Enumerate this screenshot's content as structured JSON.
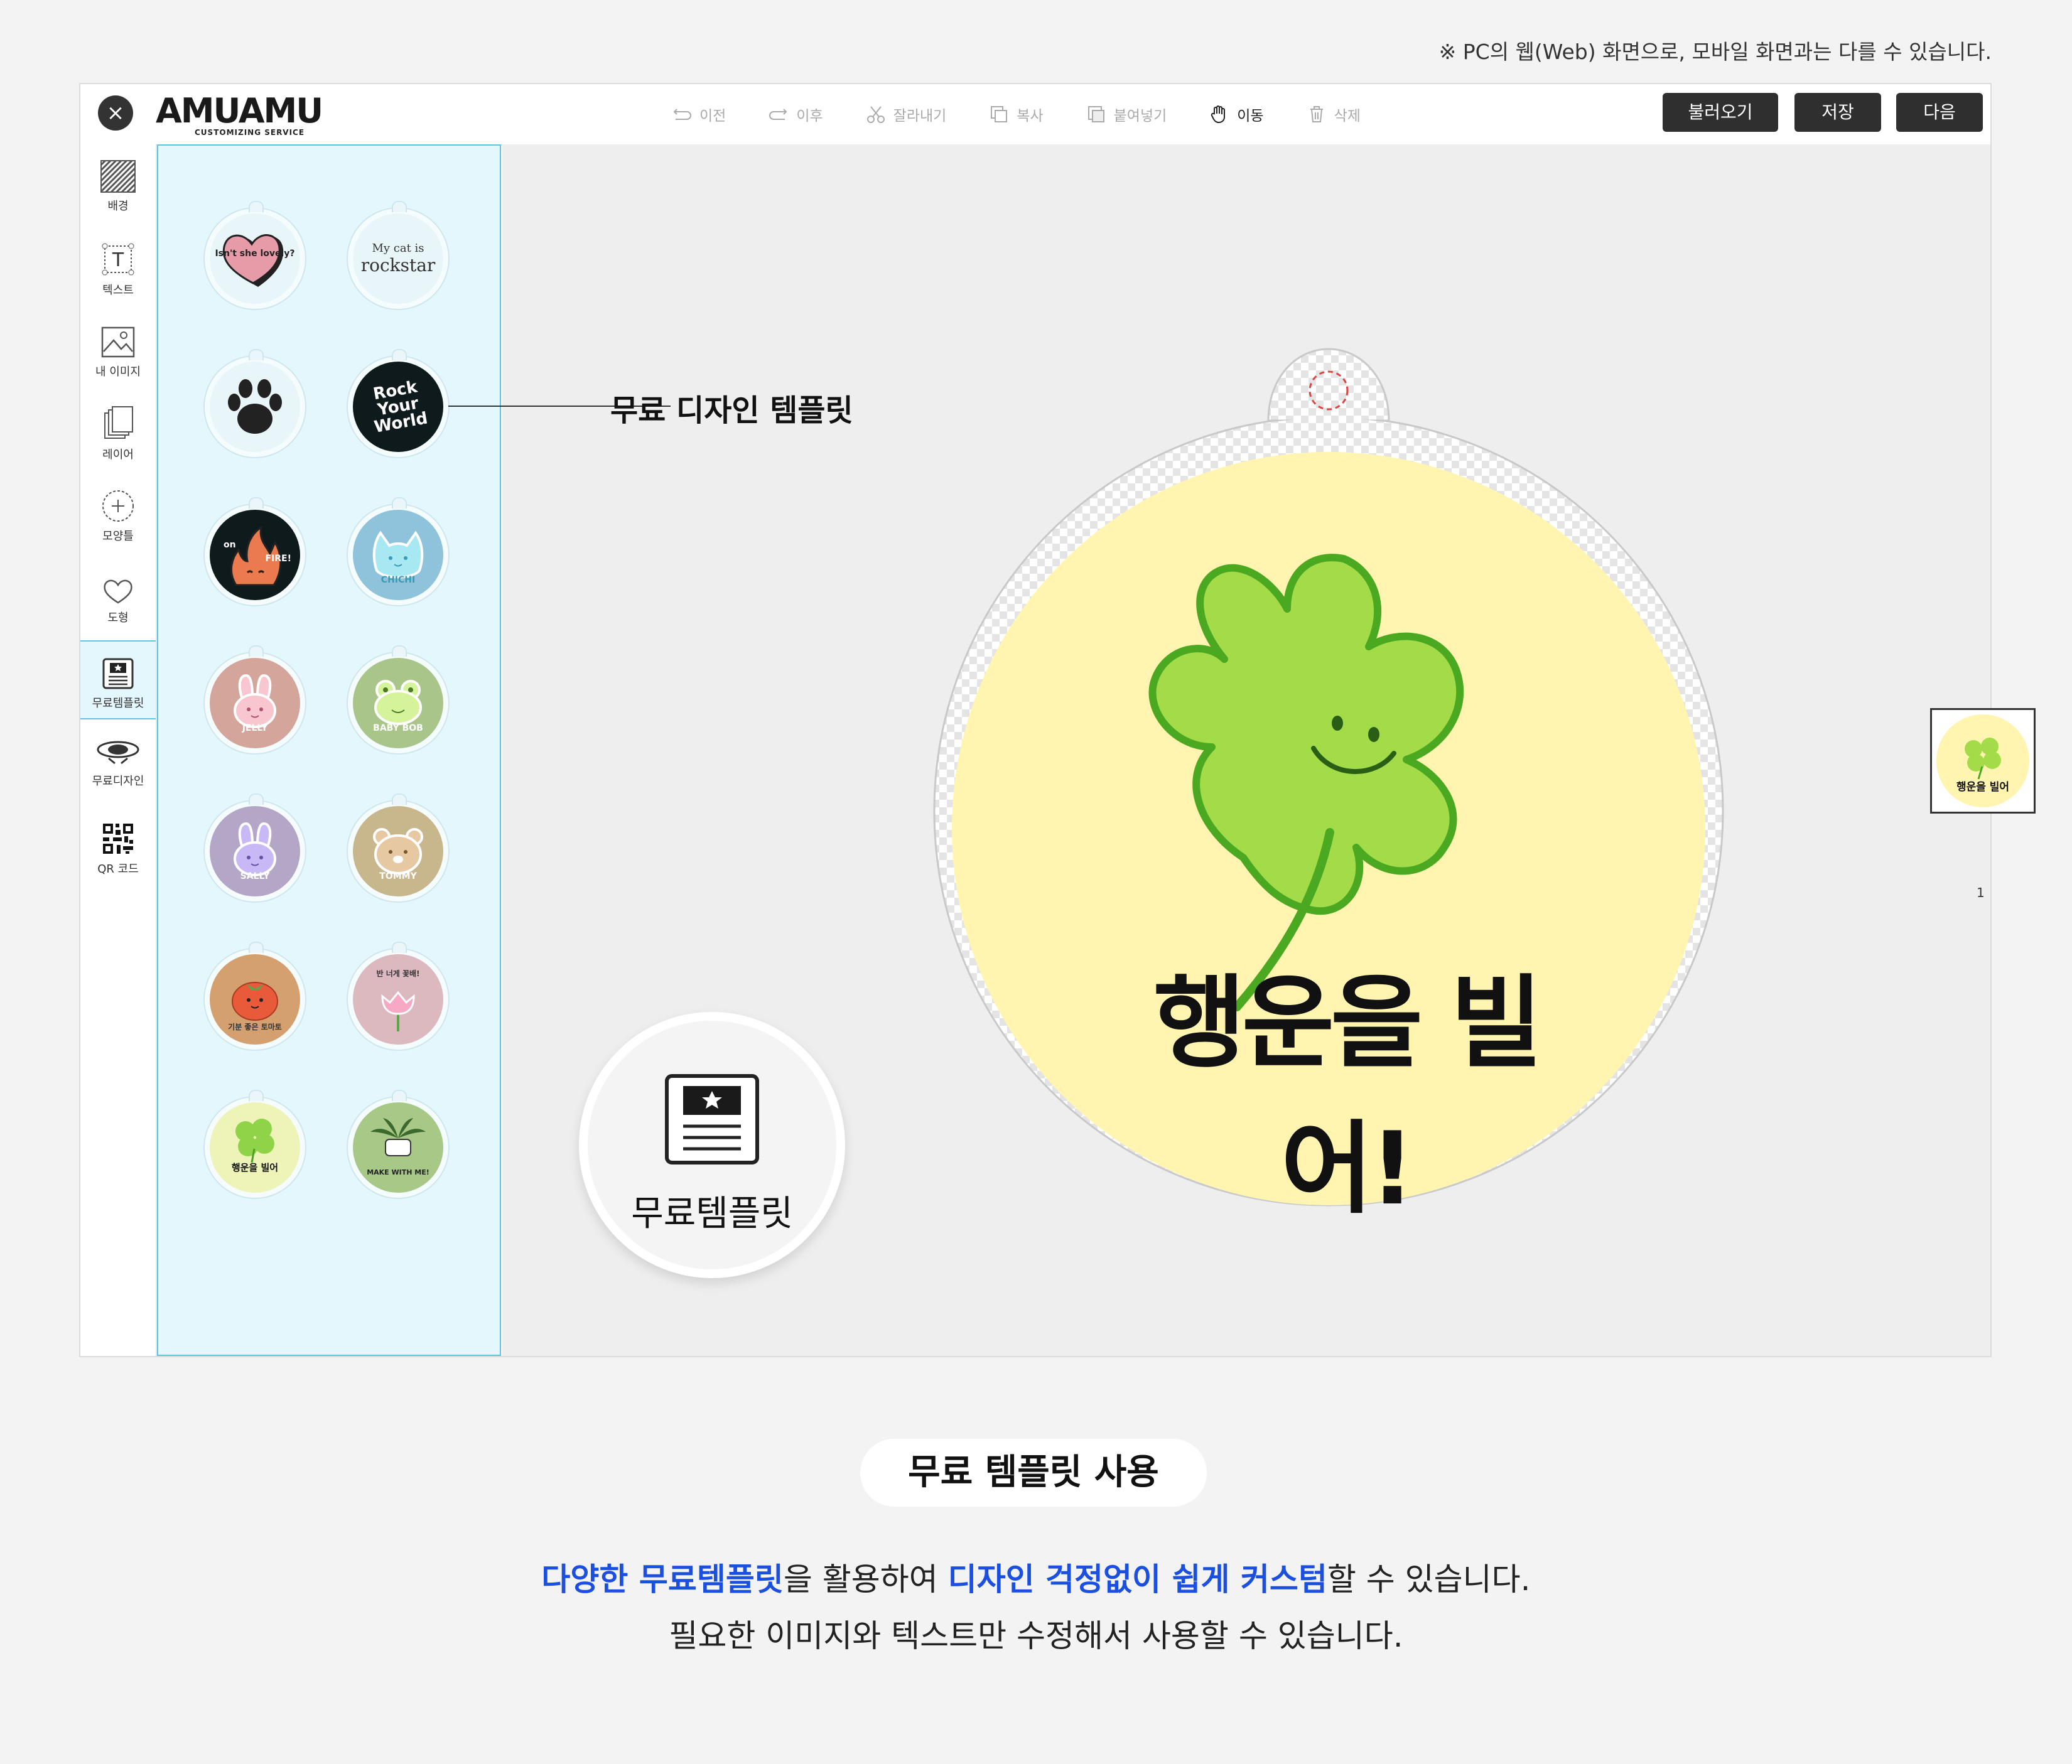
{
  "notice": "※ PC의 웹(Web) 화면으로, 모바일 화면과는 다를 수 있습니다.",
  "header": {
    "close_icon": "×",
    "logo": "AMUAMU",
    "logo_sub": "CUSTOMIZING SERVICE",
    "tools": [
      {
        "label": "이전",
        "icon": "undo-icon"
      },
      {
        "label": "이후",
        "icon": "redo-icon"
      },
      {
        "label": "잘라내기",
        "icon": "scissors-icon"
      },
      {
        "label": "복사",
        "icon": "copy-icon"
      },
      {
        "label": "붙여넣기",
        "icon": "paste-icon"
      },
      {
        "label": "이동",
        "icon": "hand-icon"
      },
      {
        "label": "삭제",
        "icon": "trash-icon"
      }
    ],
    "buttons": {
      "load": "불러오기",
      "save": "저장",
      "next": "다음"
    }
  },
  "sidebar": {
    "items": [
      {
        "label": "배경",
        "icon": "pattern-icon"
      },
      {
        "label": "텍스트",
        "icon": "text-icon"
      },
      {
        "label": "내 이미지",
        "icon": "image-icon"
      },
      {
        "label": "레이어",
        "icon": "layers-icon"
      },
      {
        "label": "모양틀",
        "icon": "shape-frame-icon"
      },
      {
        "label": "도형",
        "icon": "heart-icon"
      },
      {
        "label": "무료템플릿",
        "icon": "template-icon"
      },
      {
        "label": "무료디자인",
        "icon": "design-icon"
      },
      {
        "label": "QR 코드",
        "icon": "qr-icon"
      }
    ]
  },
  "templates": [
    {
      "name": "isnt-she-lovely",
      "text": "Isn't she lovely?"
    },
    {
      "name": "my-cat-rockstar",
      "text_small": "My cat is",
      "text": "rockstar"
    },
    {
      "name": "paw",
      "text": ""
    },
    {
      "name": "rock-your-world",
      "text": "Rock Your World"
    },
    {
      "name": "on-fire",
      "text_small": "on",
      "text": "FIRE!"
    },
    {
      "name": "chichi",
      "text": "CHICHI"
    },
    {
      "name": "jelly",
      "text": "JELLY"
    },
    {
      "name": "baby-bob",
      "text": "BABY BOB"
    },
    {
      "name": "sally",
      "text": "SALLY"
    },
    {
      "name": "tommy",
      "text": "TOMMY"
    },
    {
      "name": "tomato",
      "text": "기분 좋은 토마토"
    },
    {
      "name": "tulip",
      "text": "반 너게 꽃배!"
    },
    {
      "name": "clover",
      "text": "행운을 빌어"
    },
    {
      "name": "make-with-me",
      "text": "MAKE WITH ME!"
    }
  ],
  "canvas": {
    "callout": "무료 디자인 템플릿",
    "main_text": "행운을 빌어!",
    "badge_label": "무료템플릿",
    "thumb_text": "행운을 빌어",
    "page_number": "1"
  },
  "info": {
    "pill": "무료 템플릿 사용",
    "line1": {
      "a": "다양한 무료템플릿",
      "b": "을 활용하여 ",
      "c": "디자인 걱정없이 쉽게 커스텀",
      "d": "할 수 있습니다."
    },
    "line2": "필요한 이미지와 텍스트만 수정해서 사용할 수 있습니다."
  },
  "colors": {
    "accent": "#1a4fe0",
    "panel": "#e3f7fc",
    "panel_border": "#5cc4e6",
    "clover": "#a3dc48",
    "sticker": "#fff5b0"
  }
}
